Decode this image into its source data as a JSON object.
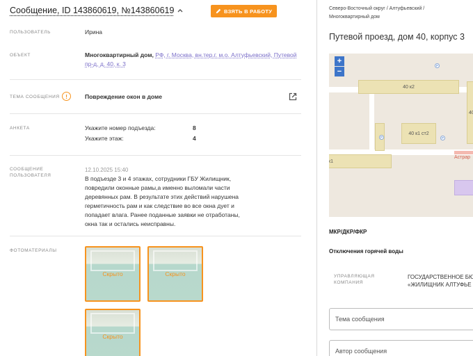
{
  "header": {
    "title": "Сообщение, ID 143860619, №143860619",
    "take_button": "ВЗЯТЬ В РАБОТУ"
  },
  "fields": {
    "user": {
      "label": "ПОЛЬЗОВАТЕЛЬ",
      "value": "Ирина"
    },
    "object": {
      "label": "ОБЪЕКТ",
      "type": "Многоквартирный дом,",
      "address_line1": "РФ, г. Москва, вн.тер.г. м.о. Алтуфьевский, Путевой",
      "address_line2": "пр-д, д. 40, к. 3"
    },
    "topic": {
      "label": "ТЕМА СООБЩЕНИЯ",
      "value": "Повреждение окон в доме",
      "warn_glyph": "!"
    },
    "survey": {
      "label": "АНКЕТА",
      "rows": [
        {
          "question": "Укажите номер подъезда:",
          "answer": "8"
        },
        {
          "question": "Укажите этаж:",
          "answer": "4"
        }
      ]
    },
    "message": {
      "label_line1": "СООБЩЕНИЕ",
      "label_line2": "ПОЛЬЗОВАТЕЛЯ",
      "date": "12.10.2025 15:40",
      "lines": [
        "В подъезде 3 и 4 этажах, сотрудники ГБУ Жилищник,",
        "повредили оконные рамы,а именно выломали части",
        "деревянных рам. В результате этих действий нарушена",
        "герметичность рам и как следствие во все окна дует и",
        "попадает влага. Ранее поданные заявки не отработаны,",
        "окна так и остались неисправны."
      ]
    },
    "photos": {
      "label": "ФОТОМАТЕРИАЛЫ",
      "items": [
        "Скрыто",
        "Скрыто",
        "Скрыто"
      ]
    }
  },
  "side": {
    "breadcrumb_line1": "Северо-Восточный округ / Алтуфьевский /",
    "breadcrumb_line2": "Многоквартирный дом",
    "address": "Путевой проезд, дом 40, корпус 3",
    "map": {
      "zoom_in": "+",
      "zoom_out": "−",
      "labels": [
        "40 к2",
        "40 к1 ст2",
        "к1",
        "Астрар",
        "40"
      ],
      "pin_glyph": "P"
    },
    "type": "МКР/ДКР/ФКР",
    "notice": "Отключения горячей воды",
    "company_label_line1": "УПРАВЛЯЮЩАЯ",
    "company_label_line2": "КОМПАНИЯ",
    "company_line1": "ГОСУДАРСТВЕННОЕ БЮ",
    "company_line2": "«ЖИЛИЩНИК АЛТУФЬЕ",
    "topic_field_placeholder": "Тема сообщения",
    "author_field_placeholder": "Автор сообщения"
  },
  "colors": {
    "accent": "#f7931e",
    "link": "#7b6fc9",
    "map_zoom": "#3d75c9"
  }
}
